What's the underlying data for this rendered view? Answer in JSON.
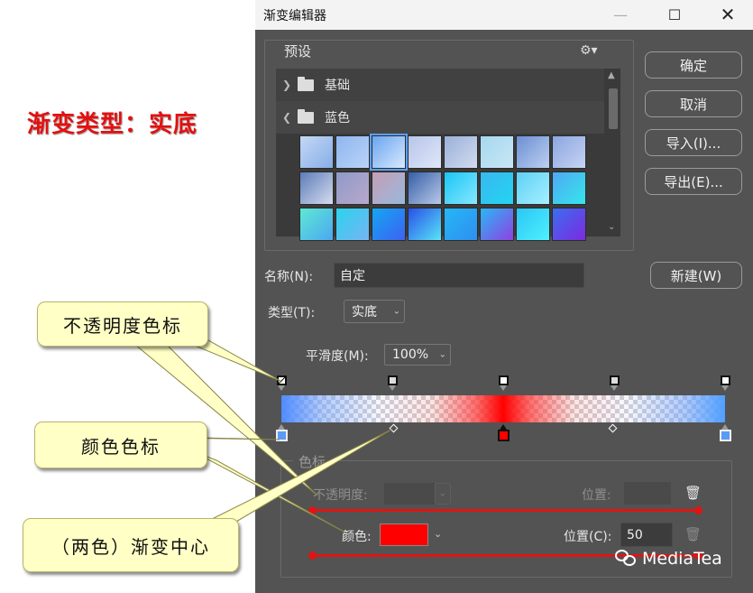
{
  "annotation": {
    "heading": "渐变类型：实底",
    "callouts": [
      "不透明度色标",
      "颜色色标",
      "（两色）渐变中心"
    ],
    "watermark": "MediaTea"
  },
  "window": {
    "title": "渐变编辑器",
    "controls": [
      "minimize-icon",
      "maximize-icon",
      "close-icon"
    ]
  },
  "presets": {
    "legend": "预设",
    "folders": [
      {
        "label": "基础",
        "expanded": false
      },
      {
        "label": "蓝色",
        "expanded": true
      }
    ],
    "swatch_colors": [
      [
        "#c4d8f4",
        "#86aee8"
      ],
      [
        "#8fb6f0",
        "#b9d3f7"
      ],
      [
        "#6aa4ef",
        "#d8e9ff"
      ],
      [
        "#b7c6ea",
        "#dfe6f8"
      ],
      [
        "#9ab0d8",
        "#d1dcf0"
      ],
      [
        "#a6d8ef",
        "#c8e6f5"
      ],
      [
        "#6c8fd4",
        "#bcd0f0"
      ],
      [
        "#8aa6e0",
        "#c7d3f3"
      ],
      [
        "#5c7db8",
        "#d6dcef"
      ],
      [
        "#8f9ac8",
        "#b8a8cc"
      ],
      [
        "#c49eb6",
        "#9ab8dc"
      ],
      [
        "#355fa8",
        "#b9c8e8"
      ],
      [
        "#19c6f5",
        "#88e6ff"
      ],
      [
        "#38b8ee",
        "#24d4f2"
      ],
      [
        "#5ed0f5",
        "#a6f0ff"
      ],
      [
        "#4fa8f3",
        "#35e6ec"
      ],
      [
        "#5ee8d4",
        "#4aa8f0"
      ],
      [
        "#2bd3ee",
        "#76b4f4"
      ],
      [
        "#14a6f2",
        "#3d62f2"
      ],
      [
        "#2850e8",
        "#58e4f8"
      ],
      [
        "#25b7f6",
        "#2f8ef0"
      ],
      [
        "#2ab8f4",
        "#8f40e4"
      ],
      [
        "#2ac6f4",
        "#50f0ff"
      ],
      [
        "#3a6ef0",
        "#7c2ae0"
      ]
    ]
  },
  "buttons": {
    "ok": "确定",
    "cancel": "取消",
    "import": "导入(I)...",
    "export": "导出(E)...",
    "new": "新建(W)"
  },
  "name": {
    "label": "名称(N):",
    "value": "自定"
  },
  "type": {
    "label": "类型(T):",
    "value": "实底"
  },
  "smoothness": {
    "label": "平滑度(M):",
    "value": "100%"
  },
  "stops": {
    "legend": "色标",
    "opacity_label": "不透明度:",
    "opacity_value": "",
    "opacity_location_label": "位置:",
    "opacity_location_value": "",
    "color_label": "颜色:",
    "color_value": "#ff0000",
    "color_location_label": "位置(C):",
    "color_location_value": "50"
  },
  "opacity_stops": [
    0,
    25,
    50,
    75,
    100
  ],
  "color_stops": [
    0,
    50,
    100
  ],
  "colors": {
    "accent_red": "#e01414",
    "selected_stop": "#ff0000",
    "end_stops": "#5a9bf5"
  }
}
